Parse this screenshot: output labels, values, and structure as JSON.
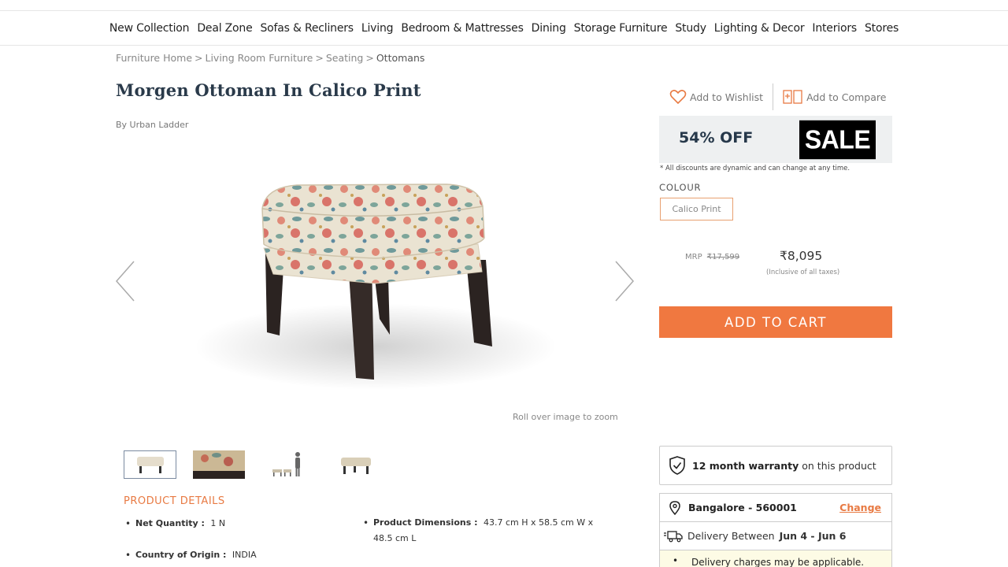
{
  "nav": [
    "New Collection",
    "Deal Zone",
    "Sofas & Recliners",
    "Living",
    "Bedroom & Mattresses",
    "Dining",
    "Storage Furniture",
    "Study",
    "Lighting & Decor",
    "Interiors",
    "Stores"
  ],
  "breadcrumb": {
    "items": [
      "Furniture Home",
      "Living Room Furniture",
      "Seating"
    ],
    "current": "Ottomans",
    "sep": ">"
  },
  "product": {
    "title": "Morgen Ottoman In Calico Print",
    "by": "By Urban Ladder",
    "zoom_hint": "Roll over image to zoom"
  },
  "actions": {
    "wishlist": "Add to Wishlist",
    "compare": "Add to Compare"
  },
  "offer": {
    "discount": "54% OFF",
    "badge": "SALE",
    "note": "* All discounts are dynamic and can change at any time."
  },
  "colour": {
    "label": "COLOUR",
    "selected": "Calico Print"
  },
  "pricing": {
    "mrp_label": "MRP",
    "mrp": "₹17,599",
    "price": "₹8,095",
    "taxes": "(Inclusive of all taxes)"
  },
  "cart_label": "ADD TO CART",
  "details": {
    "heading": "PRODUCT DETAILS",
    "specs": [
      {
        "k": "Net Quantity :",
        "v": "1 N"
      },
      {
        "k": "Product Dimensions :",
        "v": "43.7 cm H x 58.5 cm W x 48.5 cm L"
      },
      {
        "k": "Country of Origin :",
        "v": "INDIA"
      }
    ]
  },
  "warranty": {
    "bold": "12 month warranty",
    "rest": "on this product"
  },
  "location": {
    "pin": "Bangalore - 560001",
    "change": "Change"
  },
  "delivery": {
    "label": "Delivery Between",
    "dates": "Jun 4 - Jun 6",
    "charges": "Delivery charges may be applicable."
  },
  "colors": {
    "accent": "#f07840",
    "sale_bg": "#eef0f1",
    "title": "#2a3a4a"
  }
}
